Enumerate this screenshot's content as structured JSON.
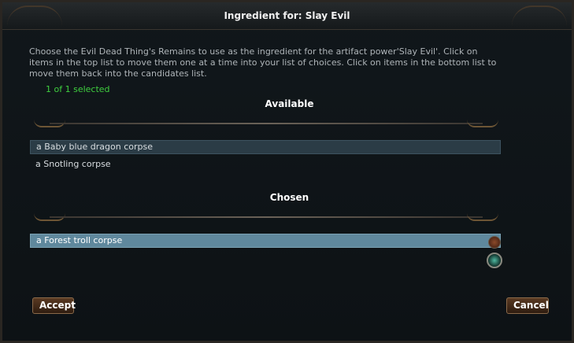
{
  "title": "Ingredient for:  Slay Evil",
  "description": "Choose the Evil Dead Thing's Remains to use as the ingredient for the artifact power'Slay Evil'.  Click on items in the top list to move them one at a time into your list of choices.  Click on items in the bottom list to move them back into the candidates list.",
  "selection_count": "1 of 1 selected",
  "available": {
    "heading": "Available",
    "items": [
      "a Baby blue dragon corpse",
      "a Snotling corpse"
    ]
  },
  "chosen": {
    "heading": "Chosen",
    "items": [
      "a Forest troll corpse"
    ]
  },
  "buttons": {
    "accept": "Accept",
    "cancel": "Cancel"
  },
  "colors": {
    "count_text": "#3fcf3f",
    "selected_row": "#5f889d",
    "highlight_row": "#2b3c46"
  }
}
